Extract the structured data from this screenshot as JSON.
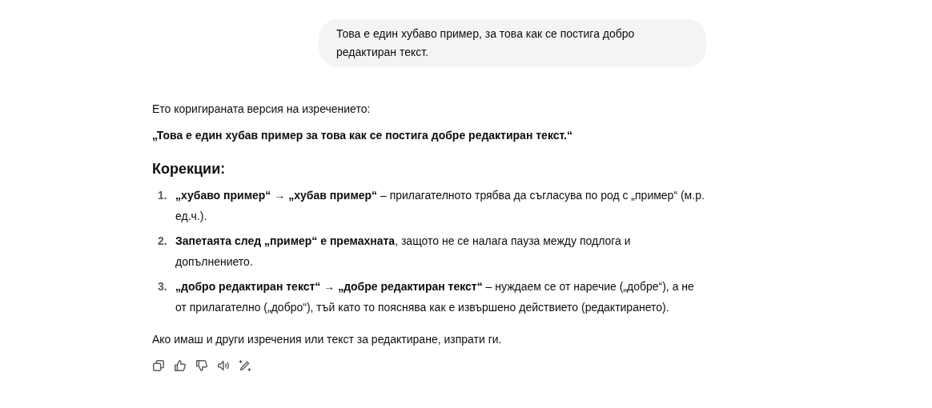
{
  "user_message": "Това е един хубаво пример, за това как се постига добро редактиран текст.",
  "reply": {
    "intro": "Ето коригираната версия на изречението:",
    "quote": "„Това е един хубав пример за това как се постига добре редактиран текст.“",
    "heading": "Корекции:",
    "corrections": [
      {
        "number": "1.",
        "text": "**„хубаво пример“ → „хубав пример“** – прилагателното трябва да съгласува по род с „пример“ (м.р. ед.ч.)."
      },
      {
        "number": "2.",
        "text": "**Запетаята след „пример“ е премахната**, защото не се налага пауза между подлога и допълнението."
      },
      {
        "number": "3.",
        "text": "**„добро редактиран текст“ → „добре редактиран текст“** – нуждаем се от наречие („добре“), а не от прилагателно („добро“), тъй като то пояснява как е извършено действието (редактирането)."
      }
    ],
    "closing": "Ако имаш и други изречения или текст за редактиране, изпрати ги.",
    "actions": [
      {
        "kind": "copy"
      },
      {
        "kind": "like"
      },
      {
        "kind": "dislike"
      },
      {
        "kind": "read"
      },
      {
        "kind": "edit"
      }
    ]
  }
}
